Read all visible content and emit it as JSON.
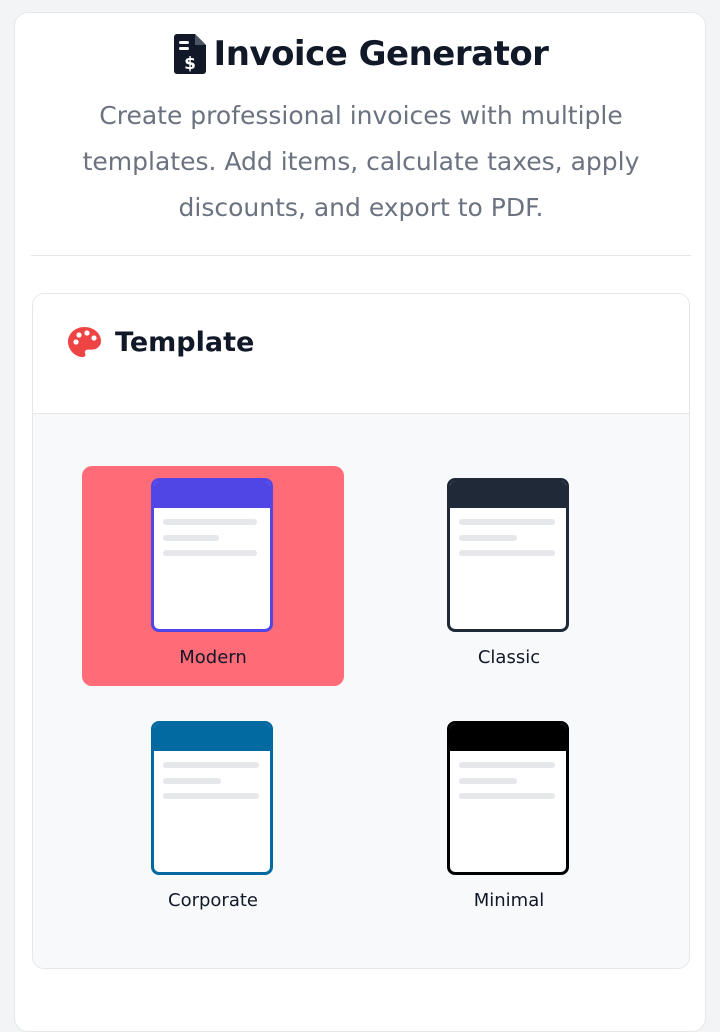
{
  "header": {
    "title": "Invoice Generator",
    "subtitle": "Create professional invoices with multiple templates. Add items, calculate taxes, apply discounts, and export to PDF.",
    "icon": "invoice-dollar-icon"
  },
  "template_section": {
    "title": "Template",
    "icon": "palette-icon",
    "selected": "Modern",
    "templates": [
      {
        "label": "Modern",
        "color": "#4f46e5"
      },
      {
        "label": "Classic",
        "color": "#1f2937"
      },
      {
        "label": "Corporate",
        "color": "#0369a1"
      },
      {
        "label": "Minimal",
        "color": "#000000"
      }
    ]
  },
  "colors": {
    "selected_bg": "#ff6b77",
    "palette_icon": "#ef4444",
    "text_primary": "#111827",
    "text_secondary": "#6b7280"
  }
}
